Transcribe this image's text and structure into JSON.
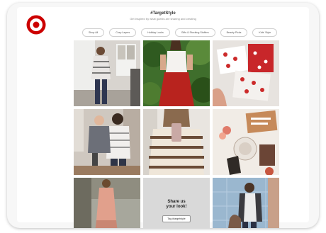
{
  "header": {
    "title": "#TargetStyle",
    "subtitle": "Get inspired by what guests are sharing and creating"
  },
  "filters": [
    "Shop All",
    "Cozy Layers",
    "Holiday Looks",
    "Gifts & Stocking Stuffers",
    "Beauty Picks",
    "Kids' Style"
  ],
  "share": {
    "title": "Share us\nyour look!",
    "button": "Tag #targetstyle"
  },
  "colors": {
    "brand": "#cc0000"
  }
}
